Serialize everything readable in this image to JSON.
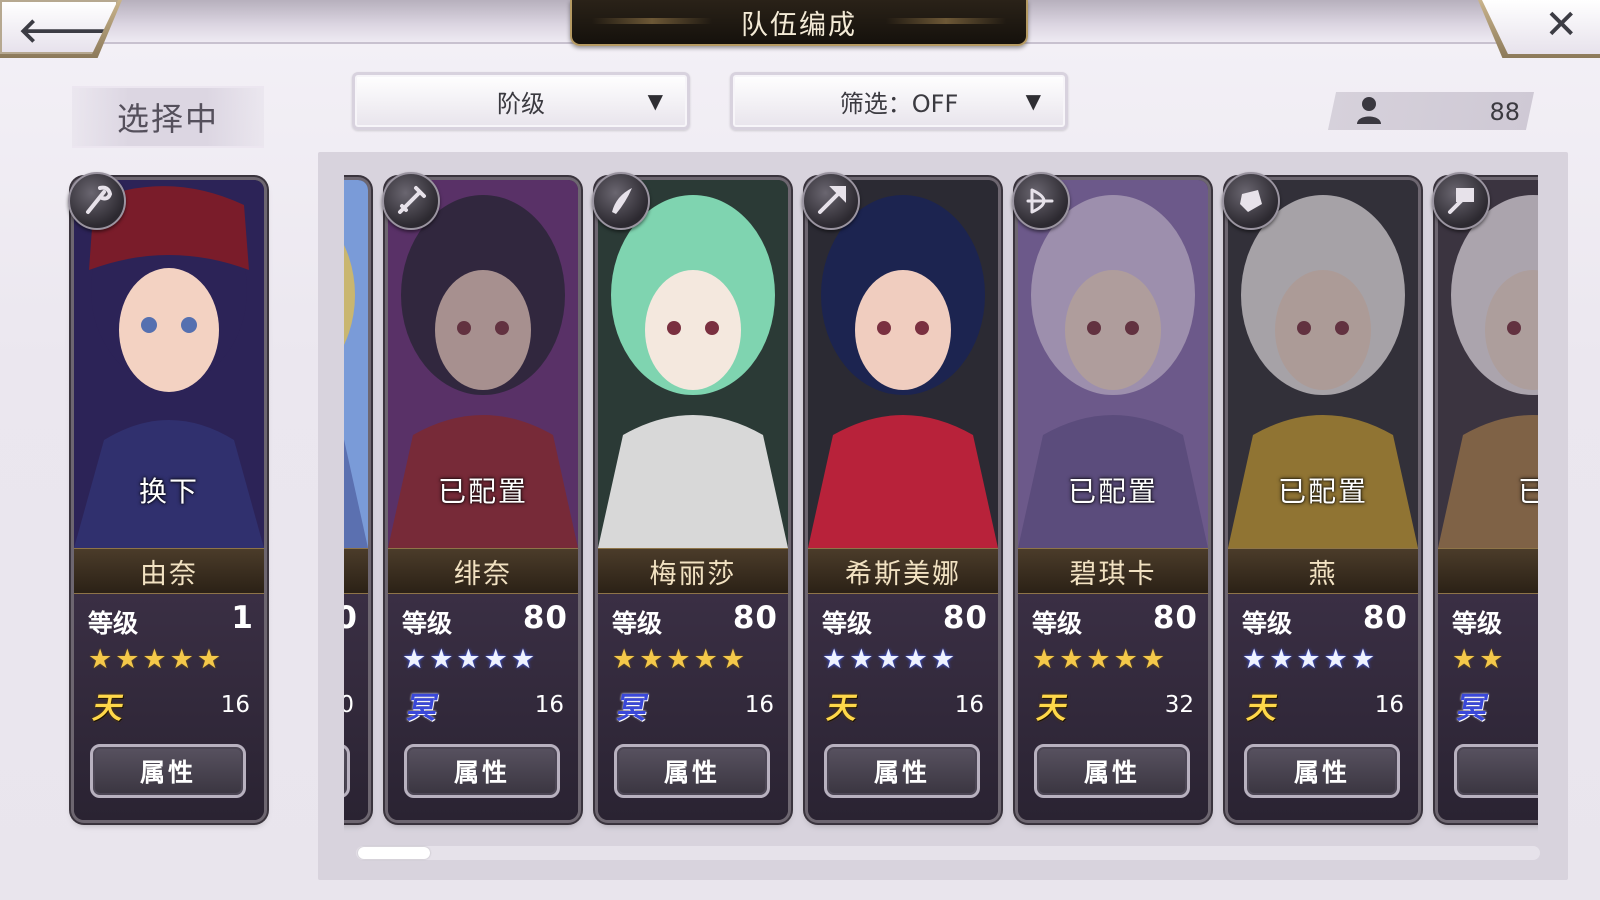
{
  "header": {
    "title": "队伍编成",
    "back_icon": "back-arrow-icon",
    "close_icon": "close-icon"
  },
  "selecting_label": "选择中",
  "sort_dropdown": {
    "label": "阶级",
    "caret": "▼"
  },
  "filter_dropdown": {
    "label": "筛选：OFF",
    "caret": "▼"
  },
  "unit_count": {
    "icon": "person-icon",
    "value": "88"
  },
  "selected_card": {
    "name": "由奈",
    "status": "换下",
    "level_label": "等级",
    "level": "1",
    "stars": "★★★★★",
    "star_color": "gold",
    "rank_badge": "天",
    "cost": "16",
    "attr_label": "属性",
    "weapon_icon": "staff-icon",
    "palette": [
      "#2c2357",
      "#7a1c2a",
      "#f3d2c2",
      "#30306e"
    ]
  },
  "cards": [
    {
      "name": "",
      "status": "",
      "level_label": "",
      "level": "0",
      "stars": "★",
      "star_color": "blue",
      "rank_badge": "",
      "cost": "0",
      "attr_label": "",
      "weapon_icon": "",
      "palette": [
        "#c9b670",
        "#7a9bd8",
        "#f2e3b8",
        "#5b70b0"
      ],
      "partial": "left"
    },
    {
      "name": "绯奈",
      "status": "已配置",
      "level_label": "等级",
      "level": "80",
      "stars": "★★★★★",
      "star_color": "blue",
      "rank_badge": "冥",
      "cost": "16",
      "attr_label": "属性",
      "weapon_icon": "sword-icon",
      "palette": [
        "#2a1d3c",
        "#6b2e7e",
        "#e9c7bf",
        "#9b2233"
      ]
    },
    {
      "name": "梅丽莎",
      "status": "",
      "level_label": "等级",
      "level": "80",
      "stars": "★★★★★",
      "star_color": "gold",
      "rank_badge": "冥",
      "cost": "16",
      "attr_label": "属性",
      "weapon_icon": "blade-icon",
      "palette": [
        "#7fd4b0",
        "#2b3a36",
        "#f4e8de",
        "#d8d8d8"
      ]
    },
    {
      "name": "希斯美娜",
      "status": "",
      "level_label": "等级",
      "level": "80",
      "stars": "★★★★★",
      "star_color": "blue",
      "rank_badge": "天",
      "cost": "16",
      "attr_label": "属性",
      "weapon_icon": "spear-icon",
      "palette": [
        "#1c2450",
        "#2b2a33",
        "#f0cdbf",
        "#b8223a"
      ]
    },
    {
      "name": "碧琪卡",
      "status": "已配置",
      "level_label": "等级",
      "level": "80",
      "stars": "★★★★★",
      "star_color": "gold",
      "rank_badge": "天",
      "cost": "32",
      "attr_label": "属性",
      "weapon_icon": "bow-icon",
      "palette": [
        "#d9c6ef",
        "#8a6fb6",
        "#f6dcd3",
        "#6e5aa0"
      ]
    },
    {
      "name": "燕",
      "status": "已配置",
      "level_label": "等级",
      "level": "80",
      "stars": "★★★★★",
      "star_color": "blue",
      "rank_badge": "天",
      "cost": "16",
      "attr_label": "属性",
      "weapon_icon": "gauntlet-icon",
      "palette": [
        "#e7e4e6",
        "#2d2d35",
        "#f1d8cb",
        "#c49a2a"
      ]
    },
    {
      "name": "",
      "status": "已",
      "level_label": "等级",
      "level": "",
      "stars": "★★",
      "star_color": "gold",
      "rank_badge": "冥",
      "cost": "",
      "attr_label": "",
      "weapon_icon": "hammer-icon",
      "palette": [
        "#efe7ef",
        "#3b3340",
        "#f3ddd3",
        "#a87c4a"
      ],
      "partial": "right"
    }
  ]
}
